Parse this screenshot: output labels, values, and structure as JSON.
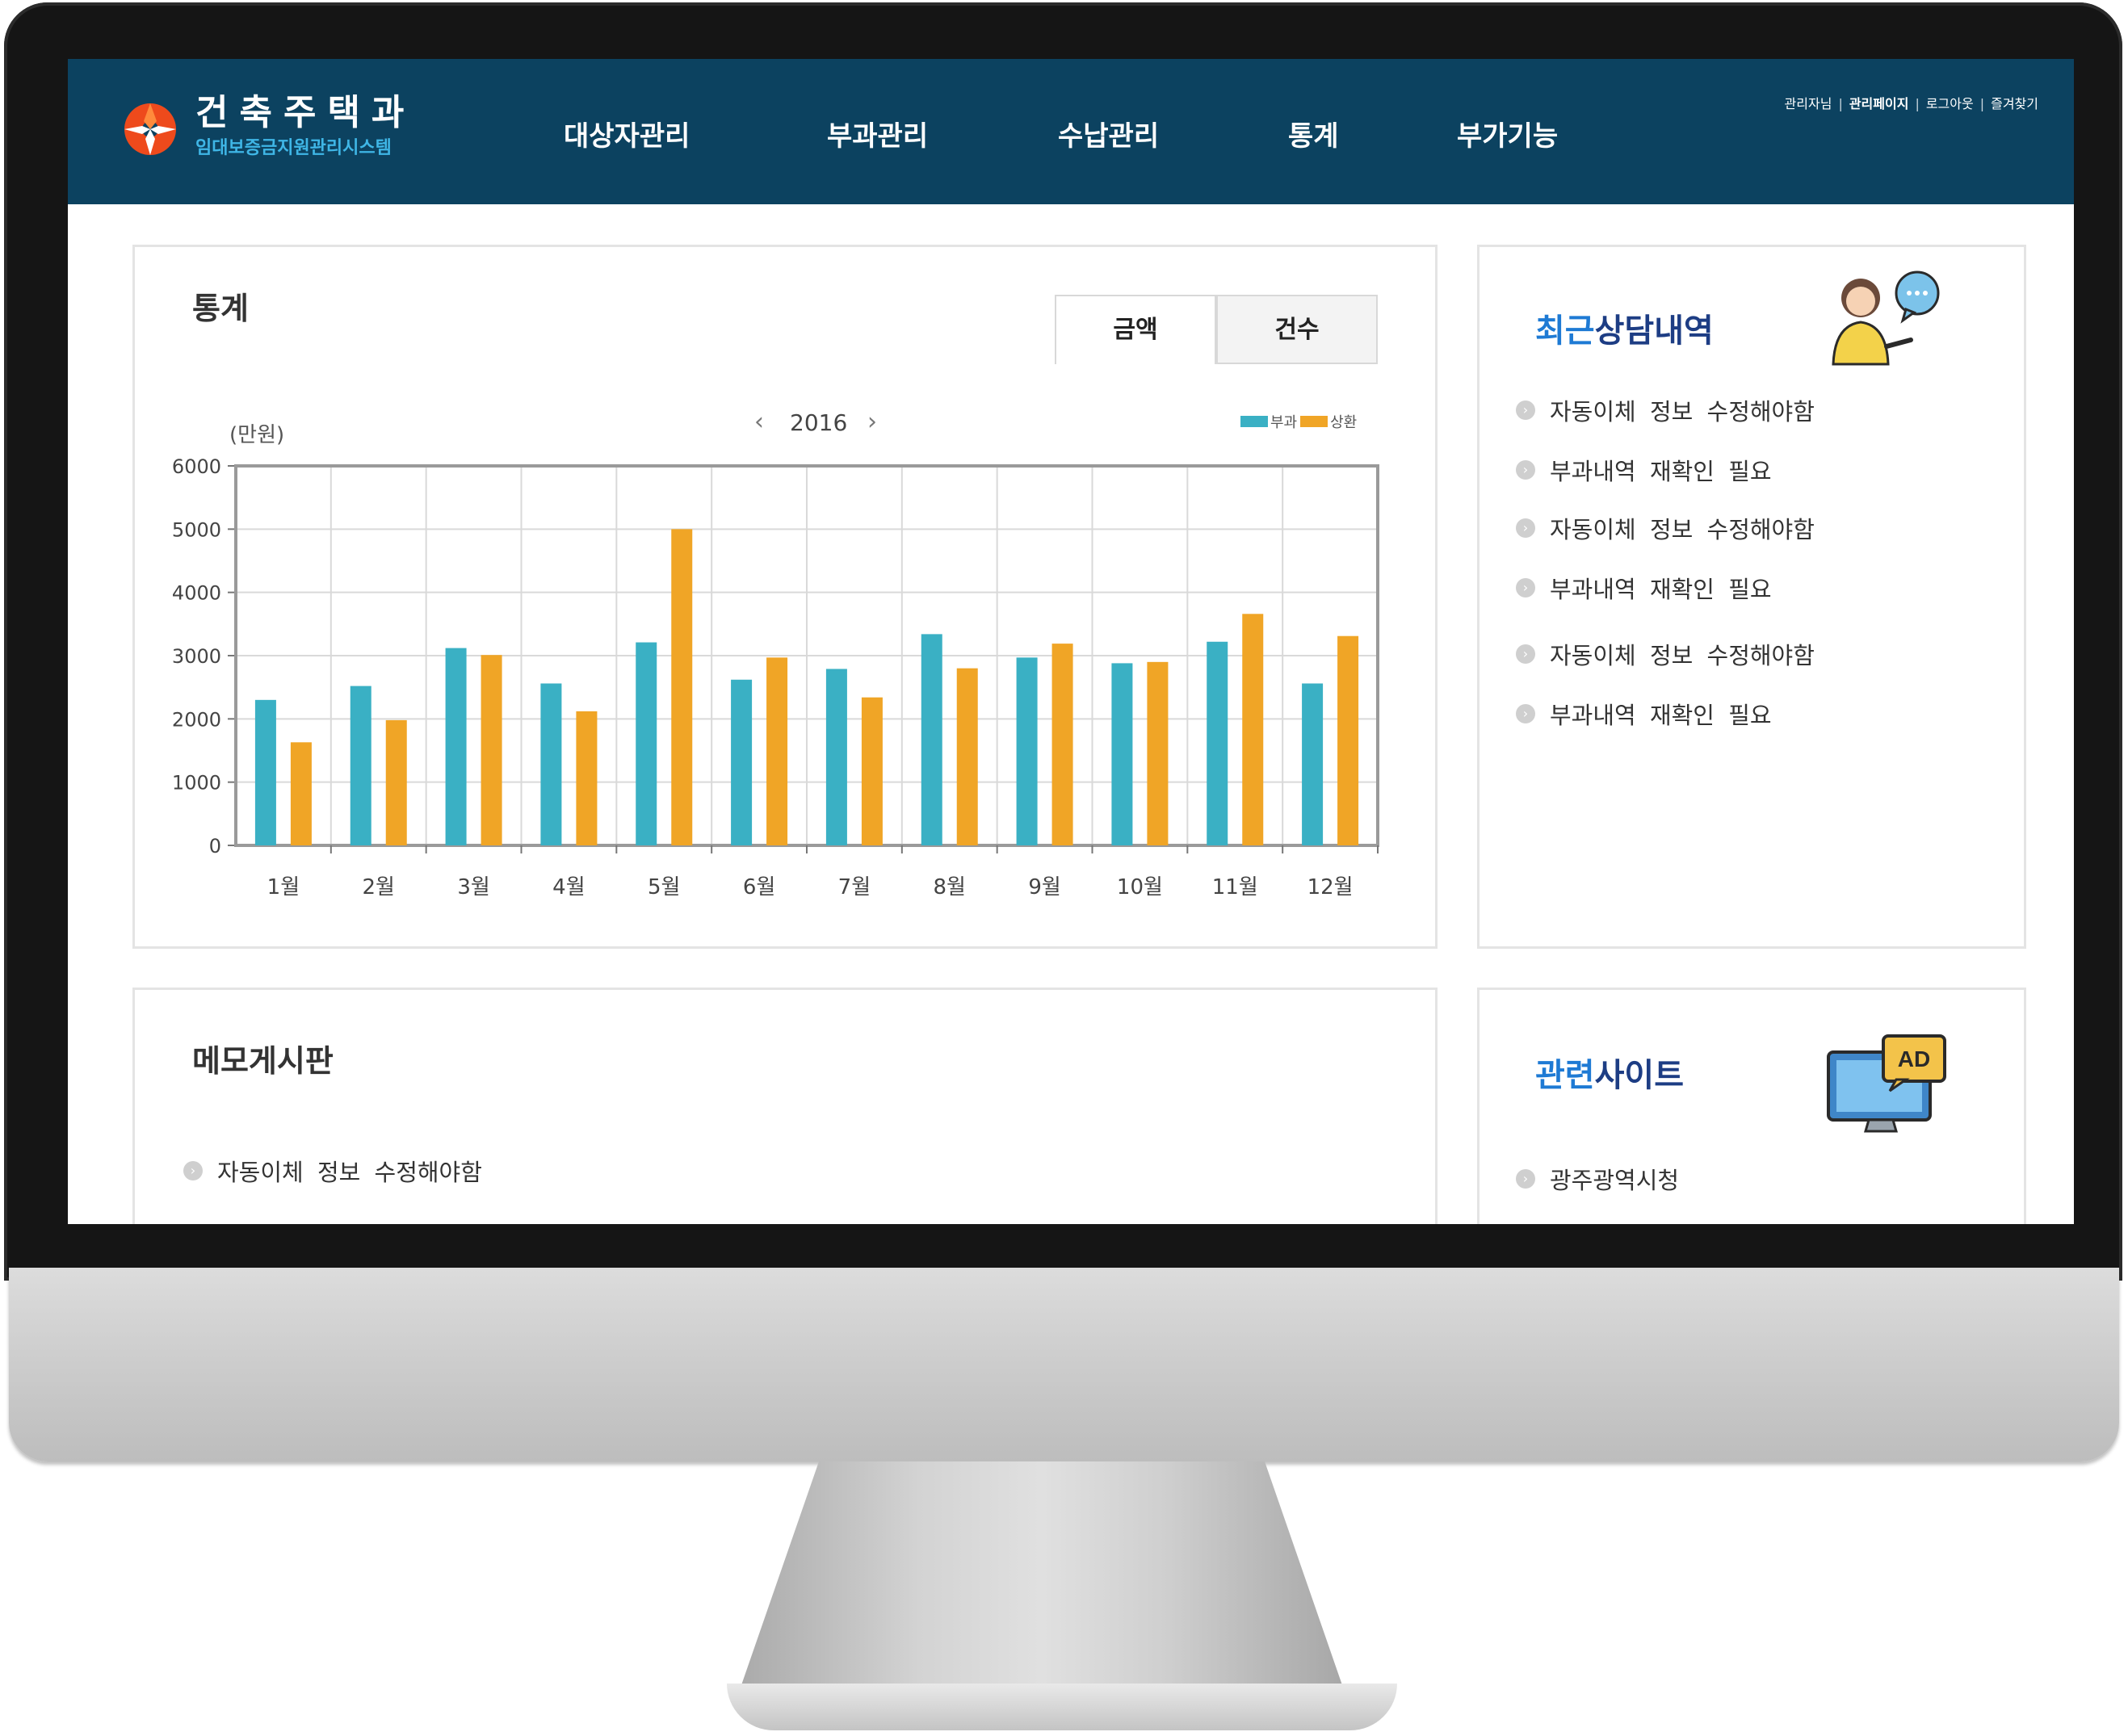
{
  "header": {
    "logo_title": "건축주택과",
    "logo_subtitle": "임대보증금지원관리시스템",
    "nav": [
      "대상자관리",
      "부과관리",
      "수납관리",
      "통계",
      "부가기능"
    ],
    "utility_links": [
      "관리자님",
      "관리페이지",
      "로그아웃",
      "즐겨찾기"
    ],
    "colors": {
      "header_bg": "#0c4260",
      "subtitle": "#3fb6e6",
      "logo_mark": "#ee4a1c"
    }
  },
  "stats": {
    "title": "통계",
    "tabs": [
      "금액",
      "건수"
    ],
    "active_tab": "금액",
    "year": "2016"
  },
  "chart_data": {
    "type": "bar",
    "unit_label": "(만원)",
    "categories": [
      "1월",
      "2월",
      "3월",
      "4월",
      "5월",
      "6월",
      "7월",
      "8월",
      "9월",
      "10월",
      "11월",
      "12월"
    ],
    "series": [
      {
        "name": "부과",
        "color": "#3ab0c4",
        "values": [
          2300,
          2520,
          3120,
          2560,
          3210,
          2620,
          2790,
          3340,
          2970,
          2880,
          3220,
          2560
        ]
      },
      {
        "name": "상환",
        "color": "#f0a526",
        "values": [
          1630,
          1980,
          3010,
          2120,
          5000,
          2970,
          2340,
          2800,
          3190,
          2900,
          3660,
          3310
        ]
      }
    ],
    "yticks": [
      "0",
      "1000",
      "2000",
      "3000",
      "4000",
      "5000",
      "6000"
    ],
    "ylim": [
      0,
      6000
    ],
    "grid": true,
    "legend": "top-right"
  },
  "consult": {
    "title_a": "최근",
    "title_b": "상담내역",
    "items": [
      "자동이체 정보 수정해야함",
      "부과내역 재확인 필요",
      "자동이체 정보 수정해야함",
      "부과내역 재확인 필요",
      "자동이체 정보 수정해야함",
      "부과내역 재확인 필요"
    ]
  },
  "memo": {
    "title": "메모게시판",
    "items": [
      "자동이체 정보 수정해야함"
    ]
  },
  "sites": {
    "title_a": "관련",
    "title_b": "사이트",
    "ad_text": "AD",
    "items": [
      "광주광역시청"
    ]
  }
}
